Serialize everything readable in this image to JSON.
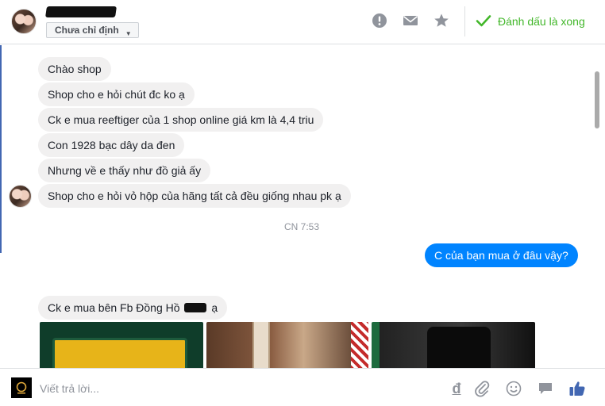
{
  "header": {
    "assign_label": "Chưa chỉ định",
    "mark_done_label": "Đánh dấu là xong",
    "icons": [
      "alert-icon",
      "mail-icon",
      "star-icon",
      "checkmark-icon"
    ],
    "accent_color": "#42b72a"
  },
  "conversation": {
    "incoming_block_1": [
      "Chào shop",
      "Shop cho e hỏi chút đc ko ạ",
      "Ck e mua reeftiger của 1 shop online giá km là 4,4 triu",
      "Con 1928 bạc dây da đen",
      "Nhưng về e thấy như đồ giả ấy",
      "Shop cho e hỏi vỏ hộp của hãng tất cả đều giống nhau pk ạ"
    ],
    "timestamp": "CN 7:53",
    "outgoing": [
      "C của bạn mua ở đâu vậy?"
    ],
    "incoming_block_2": {
      "prefix": "Ck e mua bên Fb Đồng Hồ",
      "suffix": "ạ"
    },
    "outgoing_color": "#0084ff",
    "incoming_color": "#f1f0f0"
  },
  "composer": {
    "placeholder": "Viết trả lời...",
    "currency_symbol": "đ",
    "icons": [
      "currency-icon",
      "attachment-icon",
      "emoji-icon",
      "sticker-icon",
      "like-icon"
    ],
    "like_color": "#4267b2"
  }
}
